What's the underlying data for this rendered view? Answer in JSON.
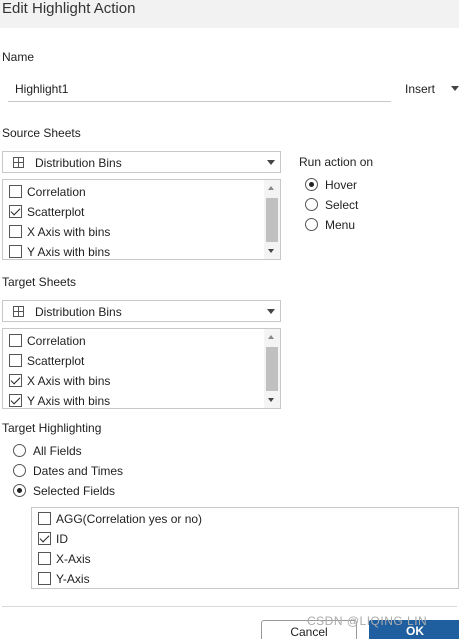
{
  "dialog": {
    "title": "Edit Highlight Action"
  },
  "name_section": {
    "label": "Name",
    "value": "Highlight1",
    "insert_label": "Insert"
  },
  "source_sheets": {
    "label": "Source Sheets",
    "dropdown_value": "Distribution Bins",
    "items": [
      {
        "label": "Correlation",
        "checked": false
      },
      {
        "label": "Scatterplot",
        "checked": true
      },
      {
        "label": "X Axis with bins",
        "checked": false
      },
      {
        "label": "Y Axis with bins",
        "checked": false
      }
    ]
  },
  "run_action": {
    "label": "Run action on",
    "options": [
      {
        "label": "Hover",
        "selected": true
      },
      {
        "label": "Select",
        "selected": false
      },
      {
        "label": "Menu",
        "selected": false
      }
    ]
  },
  "target_sheets": {
    "label": "Target Sheets",
    "dropdown_value": "Distribution Bins",
    "items": [
      {
        "label": "Correlation",
        "checked": false
      },
      {
        "label": "Scatterplot",
        "checked": false
      },
      {
        "label": "X Axis with bins",
        "checked": true
      },
      {
        "label": "Y Axis with bins",
        "checked": true
      }
    ]
  },
  "target_highlighting": {
    "label": "Target Highlighting",
    "options": [
      {
        "label": "All Fields",
        "selected": false
      },
      {
        "label": "Dates and Times",
        "selected": false
      },
      {
        "label": "Selected Fields",
        "selected": true
      }
    ],
    "fields": [
      {
        "label": "AGG(Correlation yes or no)",
        "checked": false
      },
      {
        "label": "ID",
        "checked": true
      },
      {
        "label": "X-Axis",
        "checked": false
      },
      {
        "label": "Y-Axis",
        "checked": false
      }
    ]
  },
  "footer": {
    "cancel_label": "Cancel",
    "ok_label": "OK"
  },
  "watermark": "CSDN @LIQING LIN",
  "colors": {
    "accent": "#1f5fa0",
    "border": "#c8c8c8"
  }
}
